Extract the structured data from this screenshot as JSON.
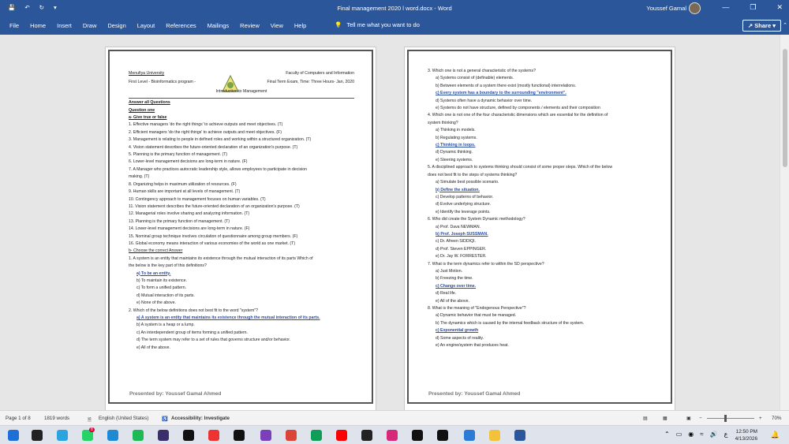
{
  "window": {
    "title": "Final management 2020 l word.docx  -  Word",
    "user": "Youssef Gamal"
  },
  "ribbon": {
    "tabs": [
      "File",
      "Home",
      "Insert",
      "Draw",
      "Design",
      "Layout",
      "References",
      "Mailings",
      "Review",
      "View",
      "Help"
    ],
    "tell_me": "Tell me what you want to do",
    "share": "Share"
  },
  "page1": {
    "header": {
      "university": "Menufiya University",
      "faculty": "Faculty of Computers and Information",
      "level": "First Level - Bioinformatics program -",
      "exam": "Final Term Exam, Time: Three Hours- Jan, 2020",
      "course": "Introduction to Management"
    },
    "lines": [
      "Answer all Questions",
      "Question one",
      "a- Give true or false",
      "1. Effective managers 'do the right things' to achieve outputs and meet objectives.   (T)",
      "2. Efficient managers 'do the right things' to achieve outputs and meet objectives. (F)",
      "3. Management is relating to people in defined roles and working within a structured organization. (T)",
      "4. Vision statement describes the future-oriented declaration of an organization's purpose. (T)",
      "5. Planning is the primary function of management. (T)",
      "6. Lower-level management decisions are long-term in nature. (F)",
      "7. A Manager who practices autocratic leadership style, allows employees to participate in decision",
      "making. (T)",
      "8. Organizing helps in maximum utilization of resources. (F)",
      "9. Human skills are important at all levels of management. (T)",
      "10. Contingency approach to management focuses on human variables. (T)",
      "11. Vision statement describes the future-oriented declaration of an organization's purpose. (T)",
      "12. Managerial roles involve sharing and analyzing information. (T)",
      "13. Planning is the primary function of management. (T)",
      "14. Lower-level management decisions are long-term in nature. (F)",
      "15. Nominal group technique involves circulation of questionnaire among group members. (F)",
      "16. Global economy means interaction of various economies of the world as one market. (T)",
      "b- Choose the correct Answer",
      "1. A system is an entity that maintains its existence through the mutual interaction of its parts Which of",
      "the below is the key part of this definitions?",
      "a) To be an entity.",
      "b) To maintain its existence.",
      "c) To form a unified pattern.",
      "d) Mutual interaction of its parts.",
      "e) None of the above.",
      "2. Which of the below definitions does not best fit to the word \"system\"?",
      "a) A system is an entity that maintains its existence through the mutual interaction of its parts.",
      "b) A system is a heap or a lump.",
      "c) An interdependent group of items forming a unified pattern.",
      "d) The term system may refer to a set of rules that governs structure and/or behavior.",
      "e) All of the above."
    ],
    "footer": "Presented by: Youssef Gamal Ahmed"
  },
  "page2": {
    "lines": [
      "3. Which one is not a general characteristic of the systems?",
      "a) Systems consist of (definable) elements.",
      "b) Between elements of a system there exist (mostly functional) interrelations.",
      "c) Every system has a boundary to the surrounding \"environment\".",
      "d) Systems often have a dynamic behavior over time.",
      "e) Systems do not have structure, defined by components / elements and their composition",
      "4. Which one is not one of the four characteristic dimensions which are essential for the definition of",
      "system thinking?",
      "a) Thinking in models.",
      "b) Regulating systems.",
      "c) Thinking in loops.",
      "d) Dynamic thinking.",
      "e) Steering systems.",
      "5. A disciplined approach to systems thinking should consist of some proper steps. Which of the below",
      "does not best fit to the steps of systems thinking?",
      "a) Simulate best possible scenario.",
      "b) Define the situation.",
      "c) Develop patterns of behavior.",
      "d) Evolve underlying structure.",
      "e) Identify the leverage points.",
      "6. Who did create the System Dynamic methodology?",
      "a) Prof. Dava NEWMAN.",
      "b) Prof. Joseph SUSSMAN.",
      "c) Dr. Afreen SIDDIQI.",
      "d) Prof. Steven EPPINGER.",
      "e) Dr. Jay W. FORRESTER.",
      "7. What is the term dynamics refer to within the SD perspective?",
      "a) Just Motion.",
      "b) Freezing the time.",
      "c) Change over time.",
      "d) Real life.",
      "e) All of the above.",
      "8. What is the meaning of \"Endogenous Perspective\"?",
      "a) Dynamic behavior that must be managed.",
      "b) The dynamics which is caused by the internal feedback structure of the system.",
      "c) Exponential growth",
      "d) Some aspects of reality.",
      "e) An engine/system that produces heat."
    ],
    "footer": "Presented by: Youssef Gamal Ahmed"
  },
  "status": {
    "page": "Page 1 of 8",
    "words": "1819 words",
    "language": "English (United States)",
    "accessibility": "Accessibility: Investigate",
    "zoom": "70%"
  },
  "taskbar": {
    "time": "12:50 PM",
    "date": "4/13/2026",
    "whatsapp_badge": "8"
  },
  "colors": {
    "ribbon": "#2b579a",
    "answer": "#2b4fa3"
  }
}
